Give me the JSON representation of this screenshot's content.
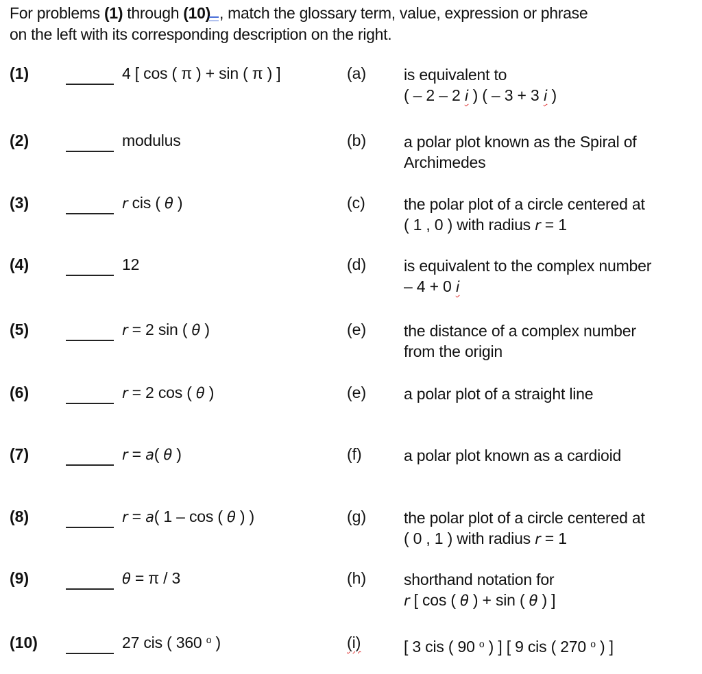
{
  "instructions": {
    "part1": "For problems ",
    "first_problem": "(1)",
    "part2": " through ",
    "last_problem": "(10)",
    "part3": ", match the glossary term, value, expression or phrase",
    "line2": "on the left with its corresponding description on the right."
  },
  "blank_label": "_____",
  "problems": [
    {
      "number": "(1)",
      "term": "4 [ cos ( π ) + sin ( π ) ]"
    },
    {
      "number": "(2)",
      "term": "modulus"
    },
    {
      "number": "(3)",
      "term_var": "r",
      "term_rest": " cis ( ",
      "term_theta": "θ",
      "term_end": " )"
    },
    {
      "number": "(4)",
      "term": "12"
    },
    {
      "number": "(5)",
      "term_var": "r",
      "term_rest": " =  2 sin ( ",
      "term_theta": "θ",
      "term_end": " )"
    },
    {
      "number": "(6)",
      "term_var": "r",
      "term_rest": " =  2 cos ( ",
      "term_theta": "θ",
      "term_end": " )"
    },
    {
      "number": "(7)",
      "term_var": "r",
      "term_eq": " =  ",
      "term_a": "a",
      "term_rest": "( ",
      "term_theta": "θ",
      "term_end": " )"
    },
    {
      "number": "(8)",
      "term_var": "r",
      "term_eq": " = ",
      "term_a": "a",
      "term_rest": "( 1  –  cos ( ",
      "term_theta": "θ",
      "term_end": " ) )"
    },
    {
      "number": "(9)",
      "term_theta": "θ",
      "term_rest": " =  π / 3"
    },
    {
      "number": "(10)",
      "term": "27 cis ( 360 ",
      "term_deg": "o",
      "term_end": " )"
    }
  ],
  "descriptions": [
    {
      "letter": "(a)",
      "line1": "is equivalent to",
      "line2_parts": [
        "( – 2  –  2 ",
        "i",
        " ) ( – 3  +  3 ",
        "i",
        " )"
      ]
    },
    {
      "letter": "(b)",
      "line1": "a polar plot known as the Spiral of",
      "line2": "Archimedes"
    },
    {
      "letter": "(c)",
      "line1": "the polar plot of a circle centered at",
      "line2_pre": "( 1 , 0 ) with radius ",
      "line2_var": "r",
      "line2_post": "  = 1"
    },
    {
      "letter": "(d)",
      "line1": "is equivalent to the complex number",
      "line2_pre": "– 4  +  0 ",
      "line2_i": "i"
    },
    {
      "letter": "(e)",
      "line1": "the distance of a complex number",
      "line2": "from the origin"
    },
    {
      "letter": "(e)",
      "line1": "a polar plot of a straight line"
    },
    {
      "letter": "(f)",
      "line1": "a polar plot known as a cardioid"
    },
    {
      "letter": "(g)",
      "line1": "the polar plot of a circle centered at",
      "line2_pre": "( 0 , 1 ) with radius ",
      "line2_var": "r",
      "line2_post": "  = 1"
    },
    {
      "letter": "(h)",
      "line1": "shorthand notation for",
      "line2_var": "r",
      "line2_a": " [ cos ( ",
      "line2_theta1": "θ",
      "line2_b": " )  +  sin ( ",
      "line2_theta2": "θ",
      "line2_c": " ) ]"
    },
    {
      "letter": "(i)",
      "line1_a": "[ 3 cis ( 90 ",
      "line1_deg1": "o",
      "line1_b": " ) ] [ 9 cis ( 270 ",
      "line1_deg2": "o",
      "line1_c": " ) ]"
    }
  ],
  "colors": {
    "text": "#111111",
    "spellcheck_underline": "#e03030",
    "grammar_mark": "#4a6fd8"
  }
}
